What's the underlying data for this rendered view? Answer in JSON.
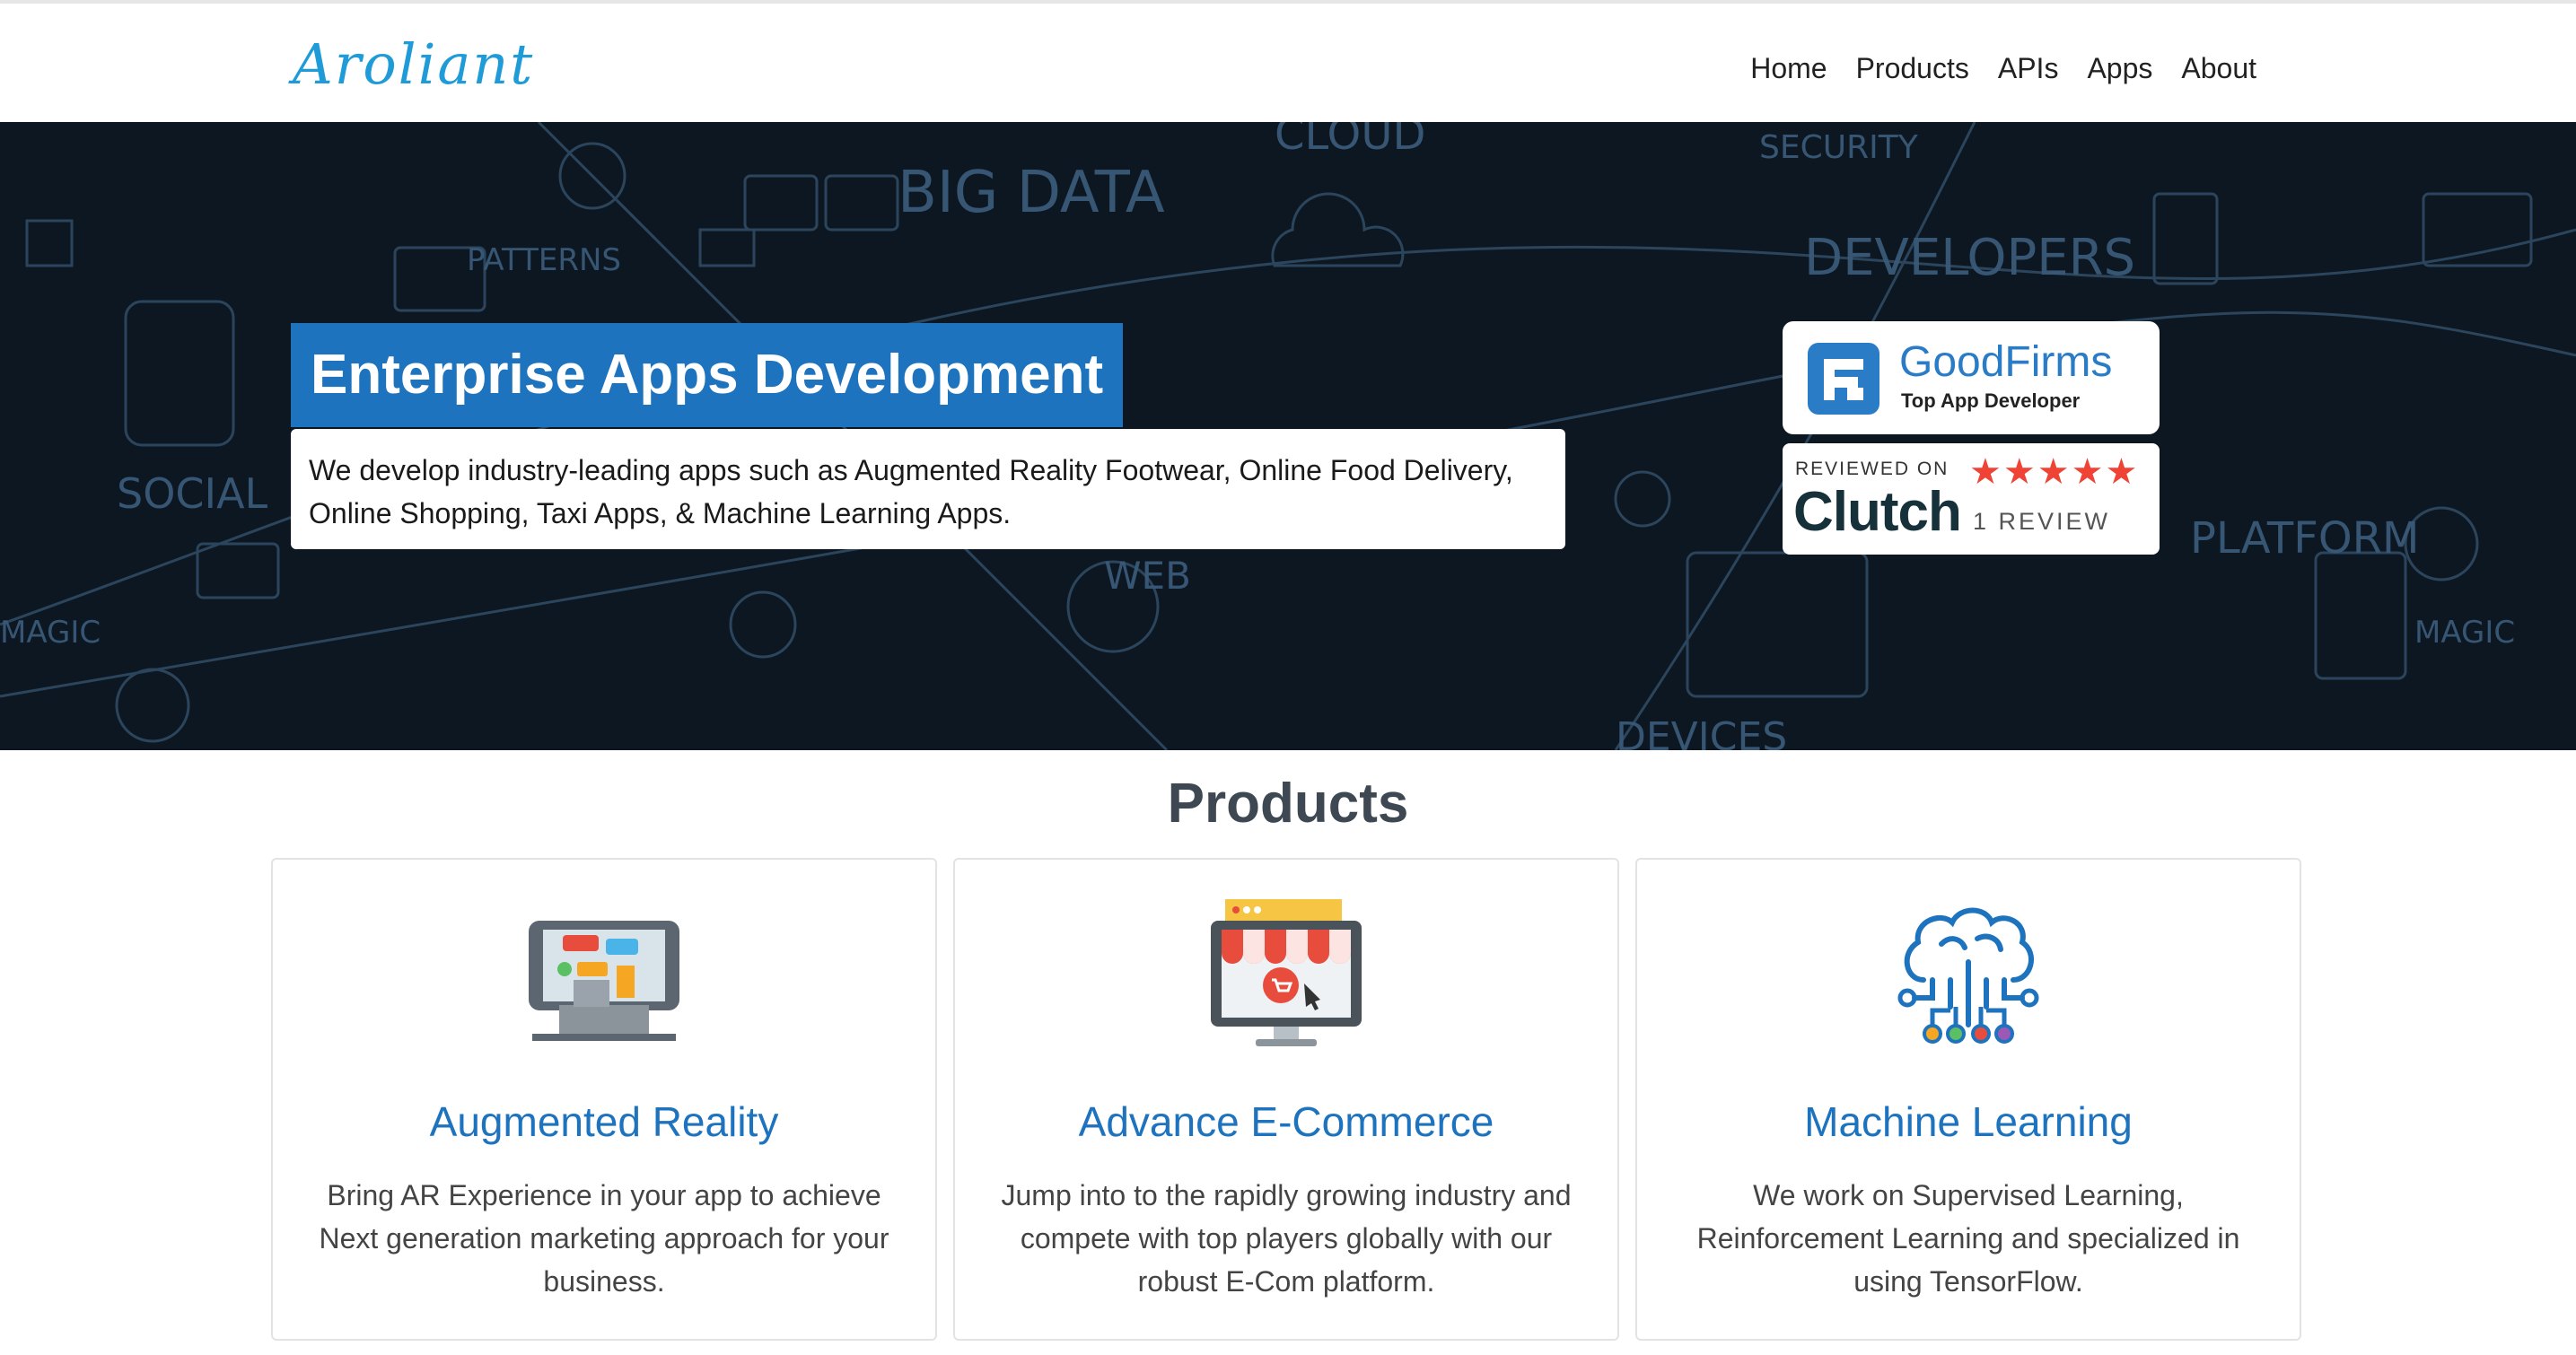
{
  "brand": {
    "logo_text": "Aroliant",
    "accent": "#1f9bd7"
  },
  "nav": {
    "items": [
      {
        "label": "Home"
      },
      {
        "label": "Products"
      },
      {
        "label": "APIs"
      },
      {
        "label": "Apps"
      },
      {
        "label": "About"
      }
    ]
  },
  "hero": {
    "title": "Enterprise Apps Development",
    "description": "We develop industry-leading apps such as Augmented Reality Footwear, Online Food Delivery, Online Shopping, Taxi Apps, & Machine Learning Apps.",
    "title_bg": "#1e73be",
    "doodle_words": [
      "BIG DATA",
      "PATTERNS",
      "SOCIAL",
      "DEVELOPERS",
      "SECURITY",
      "CLOUD",
      "WEB",
      "MAGIC",
      "MAGIC",
      "PLATFORM",
      "DEVICES"
    ]
  },
  "badges": {
    "goodfirms": {
      "name": "GoodFirms",
      "subtitle": "Top App Developer"
    },
    "clutch": {
      "reviewed_on": "REVIEWED ON",
      "name": "Clutch",
      "stars": "★★★★★",
      "rating": 5,
      "review_count": "1 REVIEW"
    }
  },
  "products": {
    "title": "Products",
    "cards": [
      {
        "icon": "ar-tablet-icon",
        "title": "Augmented Reality",
        "description": "Bring AR Experience in your app to achieve Next generation marketing approach for your business."
      },
      {
        "icon": "ecommerce-store-icon",
        "title": "Advance E-Commerce",
        "description": "Jump into to the rapidly growing industry and compete with top players globally with our robust E-Com platform."
      },
      {
        "icon": "machine-learning-brain-icon",
        "title": "Machine Learning",
        "description": "We work on Supervised Learning, Reinforcement Learning and specialized in using TensorFlow."
      }
    ]
  }
}
